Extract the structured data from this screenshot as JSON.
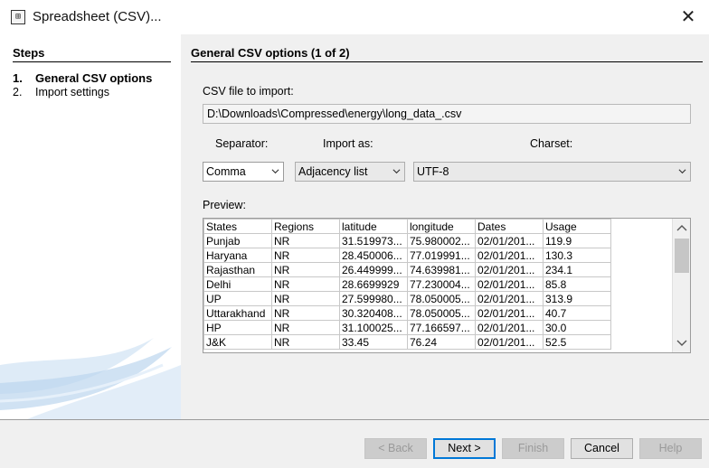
{
  "window": {
    "title": "Spreadsheet (CSV)...",
    "close_glyph": "✕",
    "app_icon": "spreadsheet-app-icon"
  },
  "steps": {
    "heading": "Steps",
    "items": [
      {
        "num": "1.",
        "label": "General CSV options",
        "active": true
      },
      {
        "num": "2.",
        "label": "Import settings",
        "active": false
      }
    ]
  },
  "main": {
    "heading": "General CSV options (1 of 2)",
    "file_label": "CSV file to import:",
    "file_path": "D:\\Downloads\\Compressed\\energy\\long_data_.csv",
    "separator_label": "Separator:",
    "import_as_label": "Import as:",
    "charset_label": "Charset:",
    "separator_value": "Comma",
    "import_as_value": "Adjacency list",
    "charset_value": "UTF-8",
    "preview_label": "Preview:"
  },
  "preview": {
    "columns": [
      "States",
      "Regions",
      "latitude",
      "longitude",
      "Dates",
      "Usage"
    ],
    "rows": [
      [
        "Punjab",
        "NR",
        "31.519973...",
        "75.980002...",
        "02/01/201...",
        "119.9"
      ],
      [
        "Haryana",
        "NR",
        "28.450006...",
        "77.019991...",
        "02/01/201...",
        "130.3"
      ],
      [
        "Rajasthan",
        "NR",
        "26.449999...",
        "74.639981...",
        "02/01/201...",
        "234.1"
      ],
      [
        "Delhi",
        "NR",
        "28.6699929",
        "77.230004...",
        "02/01/201...",
        "85.8"
      ],
      [
        "UP",
        "NR",
        "27.599980...",
        "78.050005...",
        "02/01/201...",
        "313.9"
      ],
      [
        "Uttarakhand",
        "NR",
        "30.320408...",
        "78.050005...",
        "02/01/201...",
        "40.7"
      ],
      [
        "HP",
        "NR",
        "31.100025...",
        "77.166597...",
        "02/01/201...",
        "30.0"
      ],
      [
        "J&K",
        "NR",
        "33.45",
        "76.24",
        "02/01/201...",
        "52.5"
      ]
    ]
  },
  "buttons": {
    "back": "< Back",
    "next": "Next >",
    "finish": "Finish",
    "cancel": "Cancel",
    "help": "Help"
  },
  "colors": {
    "default_button_border": "#0078d7",
    "panel_bg": "#f0f0f0",
    "swoosh": "#bcd6ee"
  }
}
